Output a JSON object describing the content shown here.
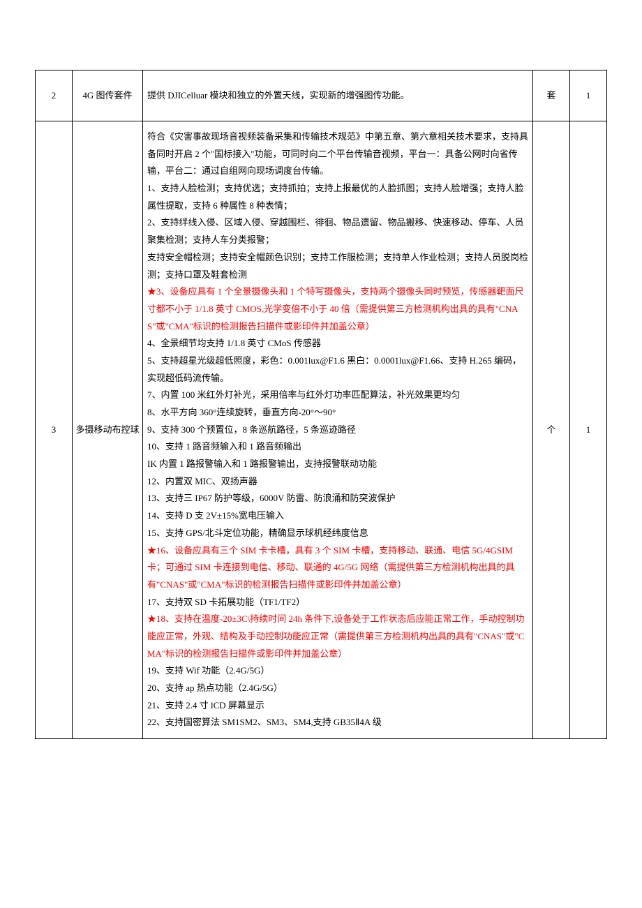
{
  "rows": [
    {
      "num": "2",
      "name": "4G 图传套件",
      "desc_plain": "提供 DJICelluar 模块和独立的外置天线，实现新的增强图传功能。",
      "unit": "套",
      "qty": "1"
    },
    {
      "num": "3",
      "name": "多摄移动布控球",
      "unit": "个",
      "qty": "1",
      "desc": {
        "p1": "符合《灾害事故现场音视频装备采集和传输技术规范》中第五章、第六章相关技术要求，支持具备同时开启 2 个\"国标接入\"功能，可同时向二个平台传输音视频，平台一：具备公网时向省传输，平台二：通过自组网向现场调度台传输。",
        "p2": "1、支持人脸检测；支持优选；支持抓拍；支持上报最优的人脸抓图；支持人脸增强；支持人脸属性提取，支持 6 种属性 8 种表情；",
        "p3": "2、支持绊线入侵、区域入侵、穿越围栏、徘徊、物品遗留、物品搬移、快速移动、停车、人员聚集检测；支持人车分类报警；",
        "p4": "支持安全帽检测；支持安全帽颜色识别；支持工作服检测；支持单人作业检测；支持人员脱岗检测；支持口罩及鞋套检测",
        "p5_red": "★3、设备应具有 1 个全景摄像头和 1 个特写摄像头，支持两个摄像头同时预览，传感器靶面尺寸都不小于 1/1.8 英寸 CMOS,光学变倍不小于 40 倍（需提供第三方检测机构出具的具有\"CNAS\"或\"CMA\"标识的检测报告扫描件或影印件并加盖公章）",
        "p6": "4、全景细节均支持 1/1.8 英寸 CMoS 传感器",
        "p7": "5、支持超星光级超低照度，彩色：0.001lux@F1.6 黑白：0.0001lux@F1.66、支持 H.265 编码，实现超低码流传输。",
        "p8": "7、内置 100 米红外灯补光，采用倍率与红外灯功率匹配算法，补光效果更均匀",
        "p9": "8、水平方向 360°连续旋转，垂直方向-20°～90°",
        "p10": "9、支持 300 个预置位，8 条巡航路径，5 条巡迹路径",
        "p11": "10、支持 1 路音频输入和 1 路音频输出",
        "p12": "IK 内置 1 路报警输入和 1 路报警输出，支持报警联动功能",
        "p13": "12、内置双 MIC、双扬声器",
        "p14": "13、支持三 IP67 防护等级，6000V 防雷、防浪涌和防突波保护",
        "p15": "14、支持 D 支 2V±15%宽电压输入",
        "p16": "15、支持 GPS/北斗定位功能，精确显示球机经纬度信息",
        "p17_red": "★16、设备应具有三个 SIM 卡卡槽，具有 3 个 SIM 卡槽，支持移动、联通、电信 5G/4GSIM 卡；可通过 SIM 卡连接到电信、移动、联通的 4G/5G 网络（需提供第三方检测机构出具的具有\"CNAS\"或\"CMA\"标识的检测报告扫描件或影印件并加盖公章）",
        "p18": "17、支持双 SD 卡拓展功能（TF1/TF2）",
        "p19_red": "★18、支持在温度-20±3C\\持续时间 24h 条件下,设备处于工作状态后应能正常工作，手动控制功能应正常，外观、结构及手动控制功能应正常（需提供第三方检测机构出具的具有\"CNAS\"或\"CMA\"标识的检测报告扫描件或影印件并加盖公章）",
        "p20": "19、支持 Wif 功能（2.4G/5G）",
        "p21": "20、支持 ap 热点功能（2.4G/5G）",
        "p22": "21、支持 2.4 寸 lCD 屏幕显示",
        "p23": "22、支持国密算法 SM1SM2、SM3、SM4,支持 GB35Ⅱ4A 级"
      }
    }
  ]
}
